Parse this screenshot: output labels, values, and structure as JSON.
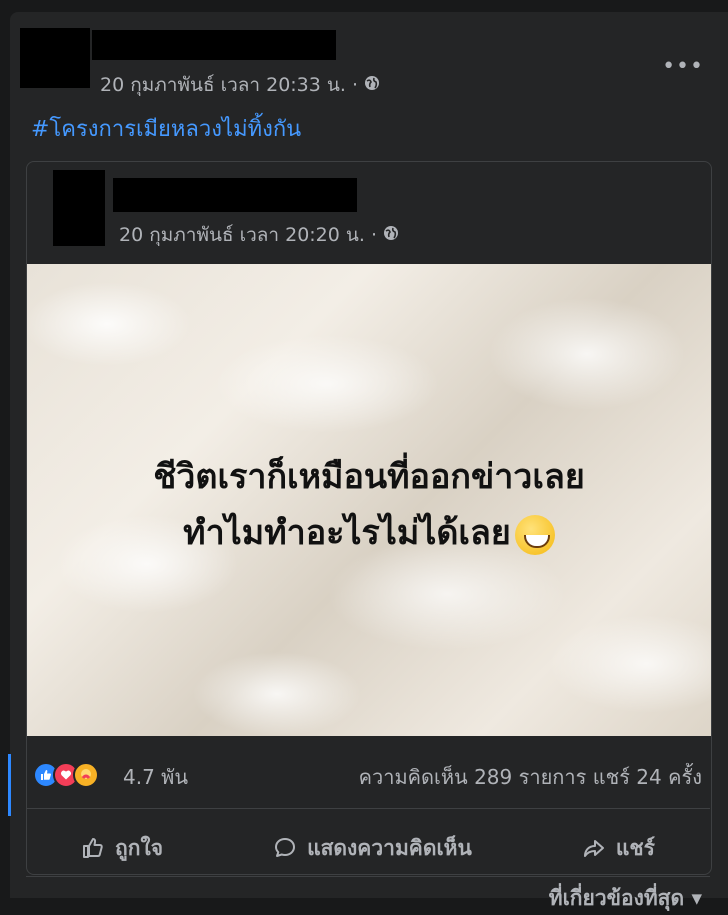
{
  "post": {
    "timestamp": "20 กุมภาพันธ์ เวลา 20:33 น. ·",
    "more_label": "•••",
    "hashtag": "#โครงการเมียหลวงไม่ทิ้งกัน"
  },
  "shared_post": {
    "timestamp": "20 กุมภาพันธ์ เวลา 20:20 น. ·",
    "caption_line1": "ชีวิตเราก็เหมือนที่ออกข่าวเลย",
    "caption_line2": "ทำไมทำอะไรไม่ได้เลย"
  },
  "stats": {
    "reaction_count": "4.7 พัน",
    "comments_shares": "ความคิดเห็น 289 รายการ แชร์ 24 ครั้ง"
  },
  "actions": {
    "like": "ถูกใจ",
    "comment": "แสดงความคิดเห็น",
    "share": "แชร์"
  },
  "sort_label": "ที่เกี่ยวข้องที่สุด ▾",
  "colors": {
    "background": "#18191a",
    "card": "#242526",
    "link": "#4599ff",
    "like": "#2d88ff",
    "love": "#f33e58",
    "care": "#f7b125"
  },
  "icons": [
    "globe-icon",
    "like-reaction-icon",
    "love-reaction-icon",
    "care-reaction-icon",
    "like-icon",
    "comment-icon",
    "share-icon",
    "emoji-icon"
  ]
}
